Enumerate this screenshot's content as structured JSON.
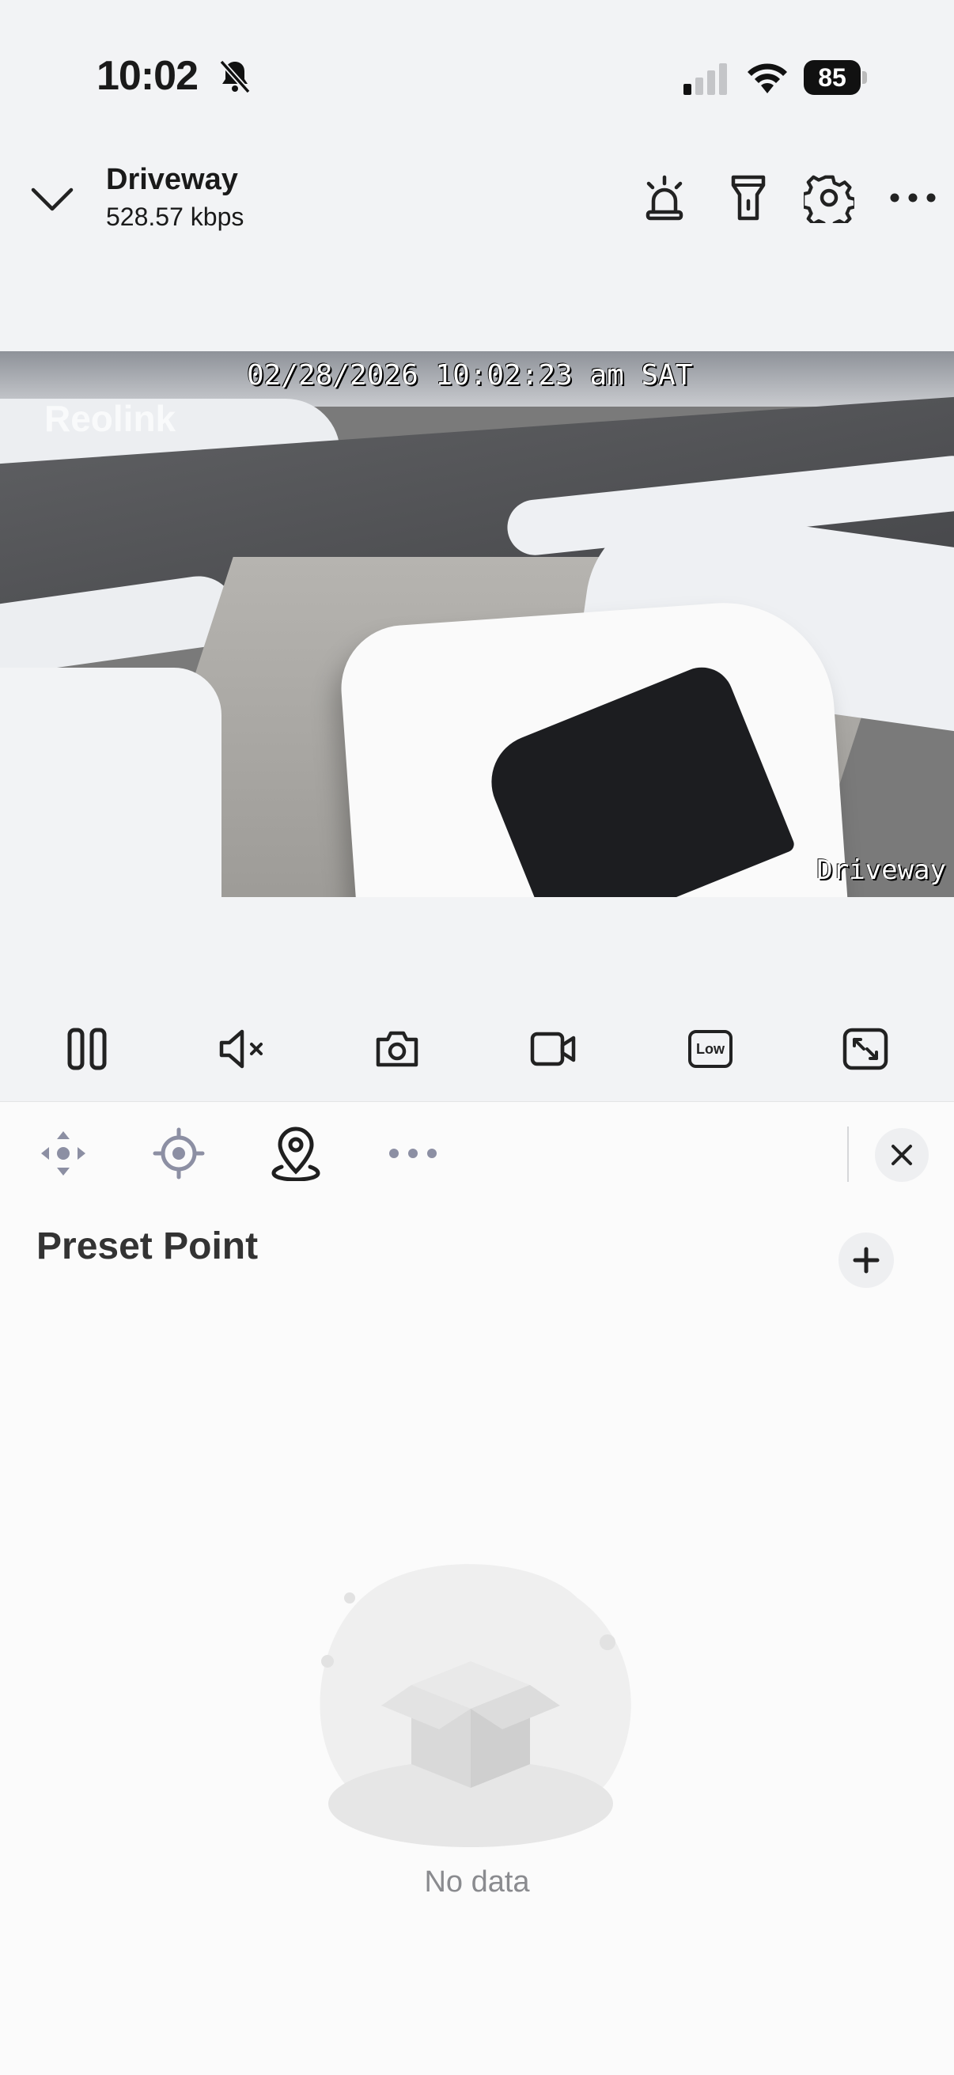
{
  "status_bar": {
    "time": "10:02",
    "battery": "85",
    "icons": [
      "bell-muted-icon",
      "signal-icon",
      "wifi-icon",
      "battery-icon"
    ]
  },
  "header": {
    "camera_name": "Driveway",
    "bitrate": "528.57 kbps",
    "actions": [
      "siren-icon",
      "spotlight-icon",
      "gear-icon",
      "more-icon"
    ]
  },
  "video": {
    "osd_timestamp": "02/28/2026 10:02:23 am SAT",
    "osd_logo": "Reolink",
    "osd_camera_name": "Driveway"
  },
  "toolbar": {
    "items": [
      "pause-icon",
      "mute-icon",
      "snapshot-icon",
      "record-icon",
      "quality-low-icon",
      "fullscreen-icon"
    ],
    "quality_label": "Low"
  },
  "panel": {
    "tabs": [
      "ptz-icon",
      "focus-icon",
      "preset-point-icon",
      "more-icon"
    ],
    "title": "Preset Point",
    "empty_text": "No data"
  },
  "colors": {
    "background": "#f2f3f5",
    "panel": "#fbfbfb",
    "icon": "#1f1f1f",
    "muted_icon": "#8c8fa3",
    "empty_text": "#8a8b8f"
  }
}
